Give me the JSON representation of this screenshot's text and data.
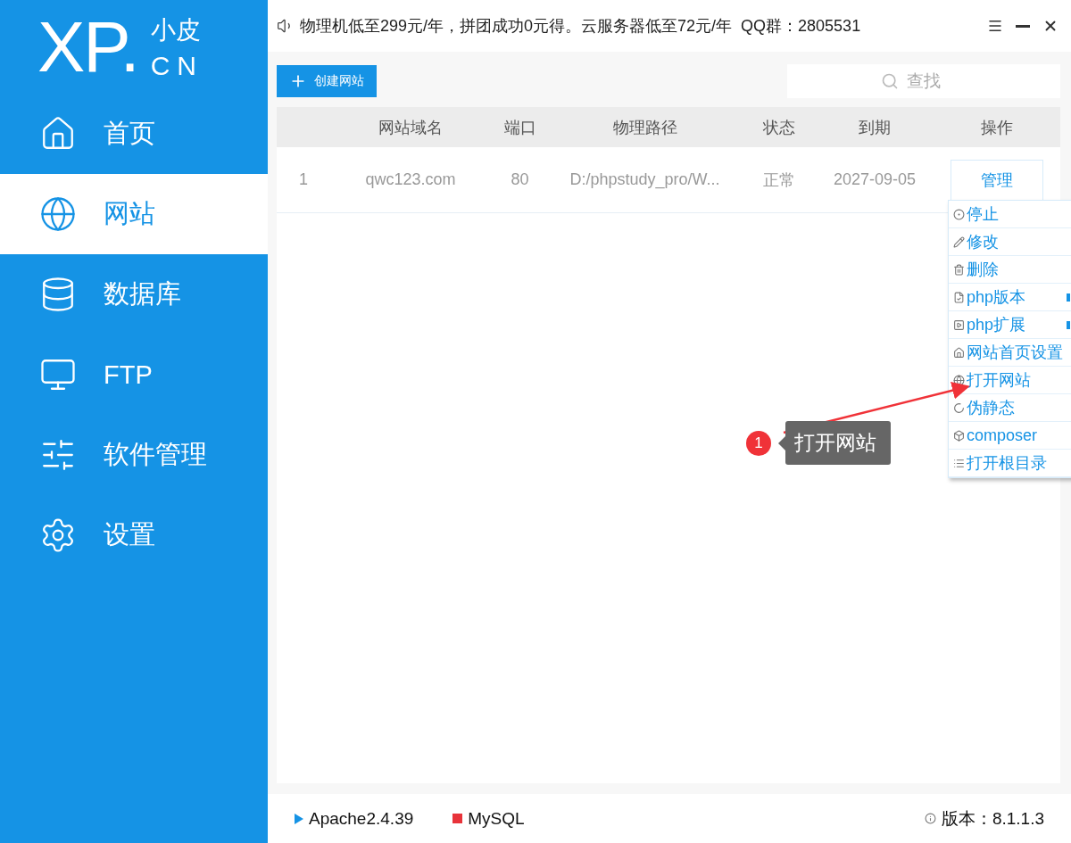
{
  "logo": {
    "mark": "XP.",
    "title": "小皮",
    "subtitle": "CN"
  },
  "sidebar": {
    "items": [
      {
        "label": "首页",
        "selected": false
      },
      {
        "label": "网站",
        "selected": true
      },
      {
        "label": "数据库",
        "selected": false
      },
      {
        "label": "FTP",
        "selected": false
      },
      {
        "label": "软件管理",
        "selected": false
      },
      {
        "label": "设置",
        "selected": false
      }
    ]
  },
  "notice": "物理机低至299元/年，拼团成功0元得。云服务器低至72元/年  QQ群：2805531",
  "toolbar": {
    "create_button": "创建网站",
    "search": {
      "placeholder": "查找"
    }
  },
  "table": {
    "columns": [
      "",
      "网站域名",
      "端口",
      "物理路径",
      "状态",
      "到期",
      "操作"
    ],
    "rows": [
      {
        "cells": [
          "1",
          "qwc123.com",
          "80",
          "D:/phpstudy_pro/W...",
          "正常",
          "2027-09-05"
        ],
        "action": "管理"
      }
    ]
  },
  "menu": {
    "items": [
      {
        "label": "停止",
        "submenu": false
      },
      {
        "label": "修改",
        "submenu": false
      },
      {
        "label": "删除",
        "submenu": false
      },
      {
        "label": "php版本",
        "submenu": true
      },
      {
        "label": "php扩展",
        "submenu": true
      },
      {
        "label": "网站首页设置",
        "submenu": false
      },
      {
        "label": "打开网站",
        "submenu": false
      },
      {
        "label": "伪静态",
        "submenu": false
      },
      {
        "label": "composer",
        "submenu": false
      },
      {
        "label": "打开根目录",
        "submenu": false
      }
    ]
  },
  "annotation": {
    "badge": "1",
    "label": "打开网站"
  },
  "status_bar": {
    "services": [
      {
        "name": "Apache2.4.39",
        "kind": "running"
      },
      {
        "name": "MySQL",
        "kind": "stopped"
      }
    ],
    "version": "版本：8.1.1.3"
  }
}
